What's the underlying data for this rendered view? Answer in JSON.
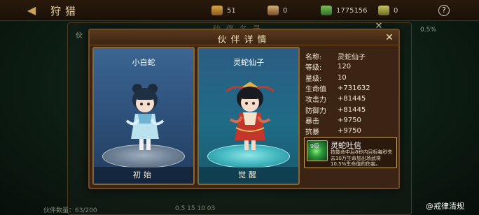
{
  "top_bar": {
    "title": "狩猎",
    "resources": [
      {
        "icon": "gold-sack-icon",
        "value": "51"
      },
      {
        "icon": "scroll-icon",
        "value": "0"
      },
      {
        "icon": "cash-icon",
        "value": "1775156"
      },
      {
        "icon": "ticket-icon",
        "value": "0"
      }
    ]
  },
  "background": {
    "panel_title": "伙伴名录",
    "side_label": "伙",
    "percent": "0.5%",
    "partner_count": "伙伴数量：63/200",
    "footer_text": "0.5 15 10 03"
  },
  "dialog": {
    "title": "伙伴详情",
    "cards": [
      {
        "name": "小白蛇",
        "label": "初始"
      },
      {
        "name": "灵蛇仙子",
        "label": "觉醒"
      }
    ],
    "stats": [
      {
        "label": "名称:",
        "value": "灵蛇仙子"
      },
      {
        "label": "等级:",
        "value": "120"
      },
      {
        "label": "星级:",
        "value": "10"
      },
      {
        "label": "生命值",
        "value": "+731632"
      },
      {
        "label": "攻击力",
        "value": "+81445"
      },
      {
        "label": "防御力",
        "value": "+81445"
      },
      {
        "label": "暴击",
        "value": "+9750"
      },
      {
        "label": "抗暴",
        "value": "+9750"
      }
    ],
    "skill": {
      "level": "9级",
      "name": "灵蛇吐信",
      "description": "技能命中后8秒内目标每秒失去30万生命加出场武将10.5%生命值的伤害。"
    }
  },
  "watermark": "@戒律清规",
  "colors": {
    "frame": "#6f4b22",
    "card_left": "#2c4f78",
    "card_right": "#1f6b86",
    "text": "#f2e8d0"
  }
}
